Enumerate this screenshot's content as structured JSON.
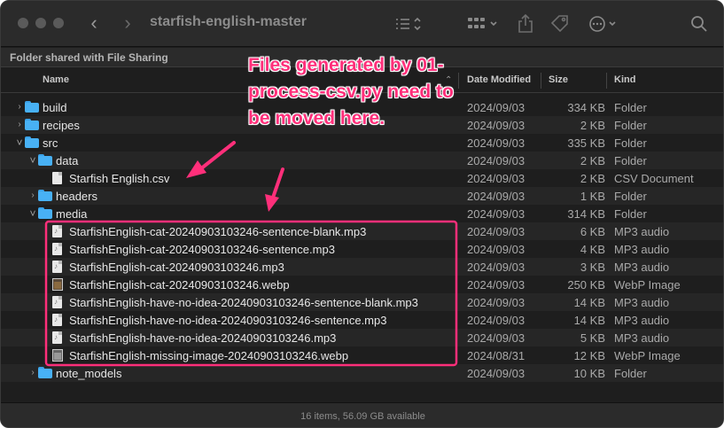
{
  "window": {
    "title": "starfish-english-master",
    "shared_banner": "Folder shared with File Sharing",
    "status": "16 items, 56.09 GB available"
  },
  "toolbar": {
    "icons": [
      "back-icon",
      "forward-icon",
      "list-view-icon",
      "group-icon",
      "share-icon",
      "tag-icon",
      "more-icon",
      "search-icon"
    ]
  },
  "columns": {
    "name": "Name",
    "date": "Date Modified",
    "size": "Size",
    "kind": "Kind"
  },
  "rows": [
    {
      "name": "build",
      "date": "2024/09/03",
      "size": "334 KB",
      "kind": "Folder",
      "depth": 0,
      "type": "folder",
      "disclosure": "collapsed"
    },
    {
      "name": "recipes",
      "date": "2024/09/03",
      "size": "2 KB",
      "kind": "Folder",
      "depth": 0,
      "type": "folder",
      "disclosure": "collapsed"
    },
    {
      "name": "src",
      "date": "2024/09/03",
      "size": "335 KB",
      "kind": "Folder",
      "depth": 0,
      "type": "folder",
      "disclosure": "expanded"
    },
    {
      "name": "data",
      "date": "2024/09/03",
      "size": "2 KB",
      "kind": "Folder",
      "depth": 1,
      "type": "folder",
      "disclosure": "expanded"
    },
    {
      "name": "Starfish English.csv",
      "date": "2024/09/03",
      "size": "2 KB",
      "kind": "CSV Document",
      "depth": 2,
      "type": "doc",
      "disclosure": "none"
    },
    {
      "name": "headers",
      "date": "2024/09/03",
      "size": "1 KB",
      "kind": "Folder",
      "depth": 1,
      "type": "folder",
      "disclosure": "collapsed"
    },
    {
      "name": "media",
      "date": "2024/09/03",
      "size": "314 KB",
      "kind": "Folder",
      "depth": 1,
      "type": "folder",
      "disclosure": "expanded"
    },
    {
      "name": "StarfishEnglish-cat-20240903103246-sentence-blank.mp3",
      "date": "2024/09/03",
      "size": "6 KB",
      "kind": "MP3 audio",
      "depth": 2,
      "type": "audio",
      "disclosure": "none"
    },
    {
      "name": "StarfishEnglish-cat-20240903103246-sentence.mp3",
      "date": "2024/09/03",
      "size": "4 KB",
      "kind": "MP3 audio",
      "depth": 2,
      "type": "audio",
      "disclosure": "none"
    },
    {
      "name": "StarfishEnglish-cat-20240903103246.mp3",
      "date": "2024/09/03",
      "size": "3 KB",
      "kind": "MP3 audio",
      "depth": 2,
      "type": "audio",
      "disclosure": "none"
    },
    {
      "name": "StarfishEnglish-cat-20240903103246.webp",
      "date": "2024/09/03",
      "size": "250 KB",
      "kind": "WebP Image",
      "depth": 2,
      "type": "image",
      "disclosure": "none"
    },
    {
      "name": "StarfishEnglish-have-no-idea-20240903103246-sentence-blank.mp3",
      "date": "2024/09/03",
      "size": "14 KB",
      "kind": "MP3 audio",
      "depth": 2,
      "type": "audio",
      "disclosure": "none"
    },
    {
      "name": "StarfishEnglish-have-no-idea-20240903103246-sentence.mp3",
      "date": "2024/09/03",
      "size": "14 KB",
      "kind": "MP3 audio",
      "depth": 2,
      "type": "audio",
      "disclosure": "none"
    },
    {
      "name": "StarfishEnglish-have-no-idea-20240903103246.mp3",
      "date": "2024/09/03",
      "size": "5 KB",
      "kind": "MP3 audio",
      "depth": 2,
      "type": "audio",
      "disclosure": "none"
    },
    {
      "name": "StarfishEnglish-missing-image-20240903103246.webp",
      "date": "2024/08/31",
      "size": "12 KB",
      "kind": "WebP Image",
      "depth": 2,
      "type": "image-gray",
      "disclosure": "none"
    },
    {
      "name": "note_models",
      "date": "2024/09/03",
      "size": "10 KB",
      "kind": "Folder",
      "depth": 1,
      "type": "folder",
      "disclosure": "collapsed"
    }
  ],
  "annotation": {
    "text": "Files generated by 01-process-csv.py need to be moved here.",
    "color": "#ff2f7a"
  }
}
